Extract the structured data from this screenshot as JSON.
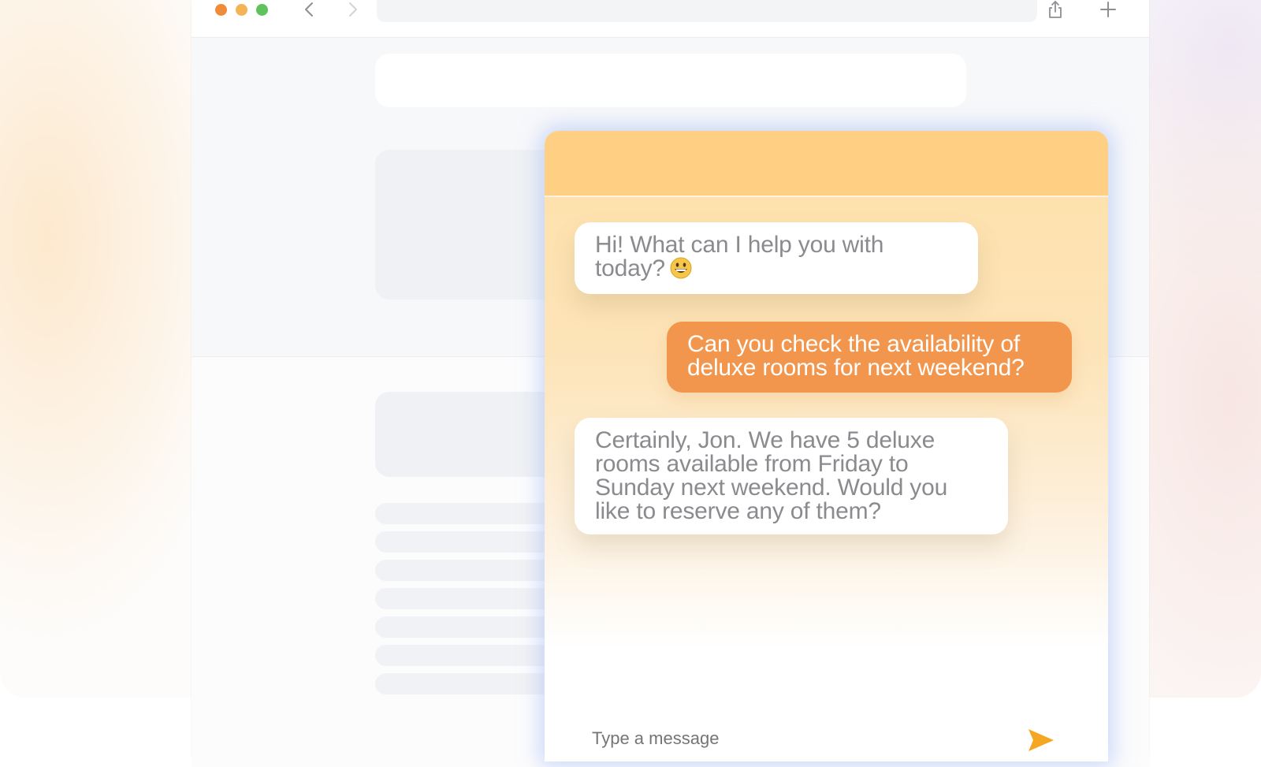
{
  "browser": {
    "icons": {
      "back": "chevron-left-icon",
      "forward": "chevron-right-icon",
      "share": "share-icon",
      "new_tab": "plus-icon"
    }
  },
  "chat": {
    "messages": [
      {
        "sender": "bot",
        "text": "Hi! What can I help you with today?",
        "emoji": "grinning-face-icon"
      },
      {
        "sender": "user",
        "text": "Can you check the availability of deluxe rooms for next weekend?"
      },
      {
        "sender": "bot",
        "text": "Certainly, Jon. We have 5 deluxe rooms available from Friday to Sunday next weekend. Would you like to reserve any of them?"
      }
    ],
    "input": {
      "placeholder": "Type a message"
    },
    "colors": {
      "header": "#ffd084",
      "user_bubble": "#f3964d",
      "bot_bubble": "#ffffff",
      "glow": "#a3b9f5"
    }
  }
}
